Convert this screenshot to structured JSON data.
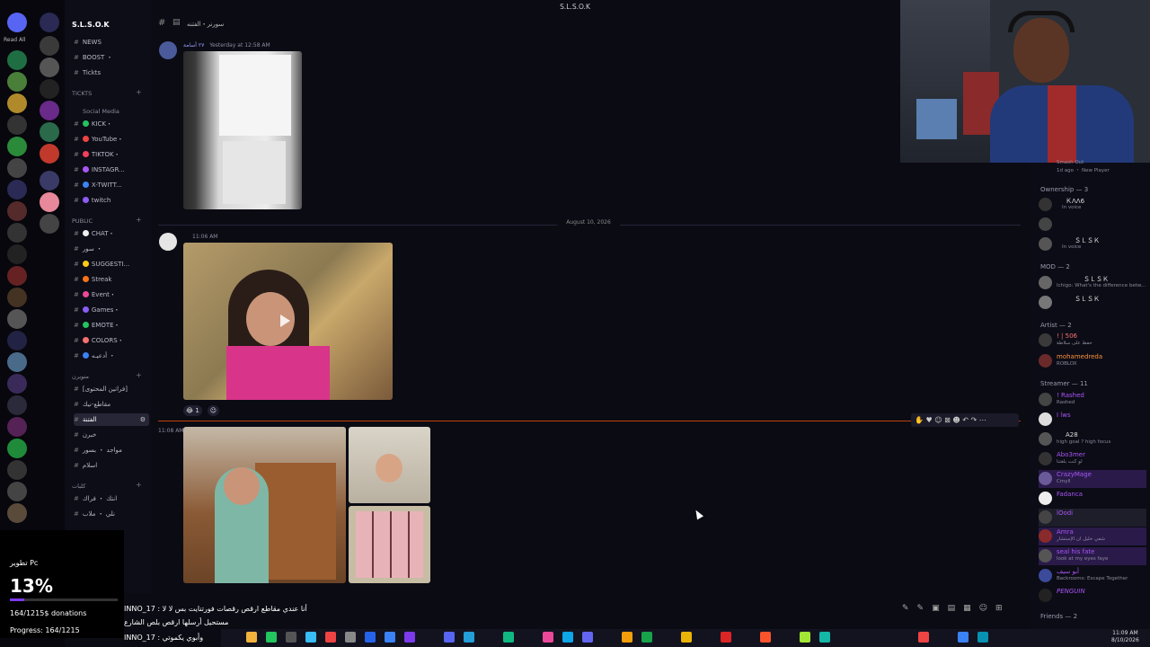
{
  "window": {
    "title": "S.L.S.O.K"
  },
  "server": {
    "name": "S.L.S.O.K",
    "read_all": "Read All"
  },
  "channels": {
    "news": "NEWS",
    "boost": "BOOST ・",
    "tickts": "Tickts",
    "tickts_category": "TICKTS",
    "social_media_category": "Social Media",
    "kick": "KICK・",
    "youtube": "YouTube・",
    "tiktok": "TIKTOK・",
    "instagram": "INSTAGR...",
    "x_twitter": "X-TWITT...",
    "twitch": "twitch",
    "public_category": "PUBLIC",
    "chat": "CHAT・",
    "sora": "سور ・",
    "suggestions": "SUGGESTI...",
    "streak": "Streak",
    "event": "Event・",
    "games": "Games・",
    "emote": "EMOTE・",
    "colors": "COLORS・",
    "adeeb": "أدعيـه ・",
    "ch_a": "[فراتين المحتوى]",
    "ch_b": "مقاطع-نيك",
    "ch_c": "الفتنة",
    "ch_d": "خبرن",
    "ch_e": "مواجد ・ بسور",
    "ch_f": "اسلام",
    "cat_a": "متويرن",
    "cat_b": "كلبات",
    "ch_g": "انتك ・ فراك",
    "ch_h": "نلي ・ ملاب"
  },
  "header": {
    "channel": "سورنر・الفتنه"
  },
  "messages": {
    "m1_author": "٢٧ أسامة",
    "m1_time": "Yesterday at 12:58 AM",
    "date_divider": "August 10, 2026",
    "m2_time": "11:06 AM",
    "m3_time": "11:08 AM",
    "reaction_count": "1"
  },
  "members": {
    "top_status_a": "Smash Out",
    "top_status_b": "1d ago ・ New Player",
    "ownership": "Ownership — 3",
    "o1_name": "ＫΛΛ6",
    "o1_status": "In voice",
    "o2_name": "ＳＬＳＫ",
    "o2_status": "In voice",
    "mod": "MOD — 2",
    "mod1_name": "ＳＬＳＫ",
    "mod1_status": "Ichigo: What's the difference betw...",
    "mod2_name": "ＳＬＳＫ",
    "artist": "Artist — 2",
    "a1_name": "! | 506",
    "a1_status": "حفظ على سلاطة",
    "a2_name": "mohamedreda",
    "a2_status": "ROBLOX",
    "streamer": "Streamer — 11",
    "s1_name": "! Rashed",
    "s1_status": "Rashed",
    "s2_name": "I lws",
    "s3_name": "A28",
    "s3_status": "high goal ? high focus",
    "s4_name": "Abo3mer",
    "s4_status": "لو كنت بلغتنا",
    "s5_name": "CrazyMage",
    "s5_status": "Cmyll",
    "s6_name": "Fadanca",
    "s7_name": "lOodi",
    "s8_name": "Amra",
    "s8_status": "شفي خليل ان الإستشار",
    "s9_name": "seal his fate",
    "s9_status": "look at my eyes faye",
    "s10_name": "أبو سيف",
    "s10_status": "Backrooms: Escape Together",
    "s11_name": "PENGUIN",
    "friends": "Friends — 2"
  },
  "overlay": {
    "title": "تطوير Pc",
    "percent": "13%",
    "progress_fraction": 0.13,
    "donations": "164/1215$ donations",
    "progress": "Progress: 164/1215"
  },
  "ticker": {
    "line1": "INNO_17 : أنا عندي مقاطع ارقص رقصات فورتنايت بس لا لا",
    "line2": "مستحيل أرسلها ارقص بلص الشارع",
    "line3": "INNO_17 : وأبوي يكموتي"
  },
  "clock": {
    "time": "11:09 AM",
    "date": "8/10/2026"
  },
  "colors": {
    "accent": "#c2410c",
    "progress": "#7c3aed",
    "link": "#9aa0ff"
  }
}
